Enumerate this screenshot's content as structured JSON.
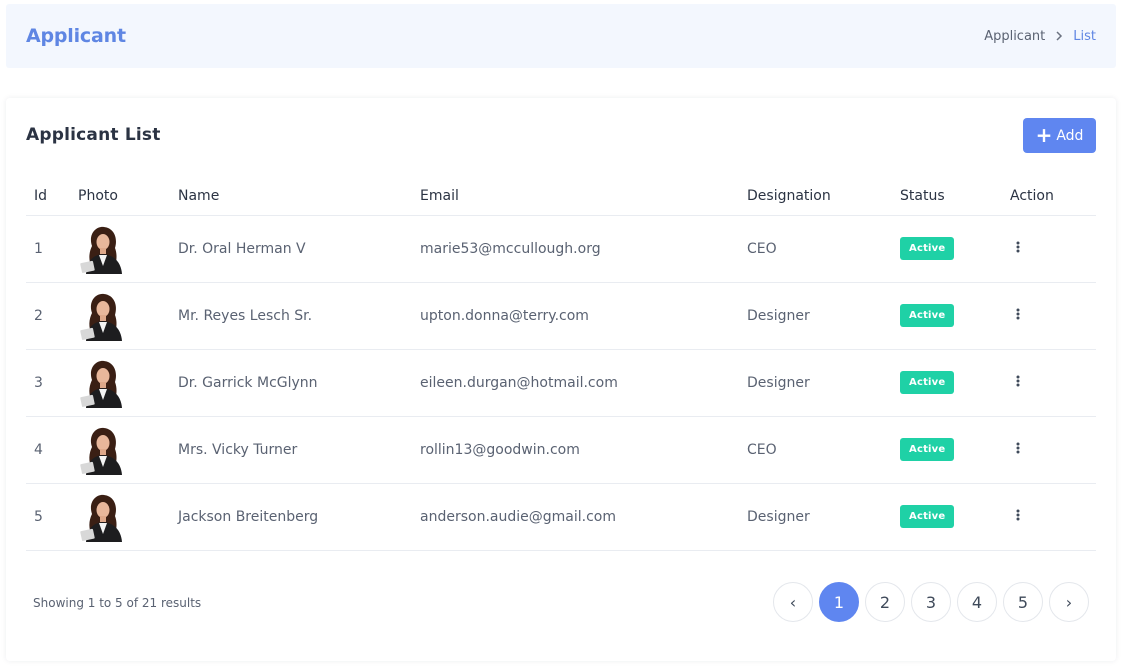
{
  "header": {
    "title": "Applicant",
    "breadcrumb": {
      "parent": "Applicant",
      "current": "List"
    }
  },
  "card": {
    "title": "Applicant List",
    "add_label": "Add"
  },
  "table": {
    "columns": [
      "Id",
      "Photo",
      "Name",
      "Email",
      "Designation",
      "Status",
      "Action"
    ],
    "rows": [
      {
        "id": "1",
        "name": "Dr. Oral Herman V",
        "email": "marie53@mccullough.org",
        "designation": "CEO",
        "status": "Active"
      },
      {
        "id": "2",
        "name": "Mr. Reyes Lesch Sr.",
        "email": "upton.donna@terry.com",
        "designation": "Designer",
        "status": "Active"
      },
      {
        "id": "3",
        "name": "Dr. Garrick McGlynn",
        "email": "eileen.durgan@hotmail.com",
        "designation": "Designer",
        "status": "Active"
      },
      {
        "id": "4",
        "name": "Mrs. Vicky Turner",
        "email": "rollin13@goodwin.com",
        "designation": "CEO",
        "status": "Active"
      },
      {
        "id": "5",
        "name": "Jackson Breitenberg",
        "email": "anderson.audie@gmail.com",
        "designation": "Designer",
        "status": "Active"
      }
    ]
  },
  "pagination": {
    "summary": "Showing 1 to 5 of 21 results",
    "prev": "‹",
    "next": "›",
    "pages": [
      "1",
      "2",
      "3",
      "4",
      "5"
    ],
    "current": "1"
  },
  "colors": {
    "accent": "#5f86f0",
    "title": "#5f86e3",
    "status_active": "#1fd1a6",
    "header_bg": "#f3f7fe"
  },
  "icons": {
    "breadcrumb_separator": "chevron-right-icon",
    "add": "plus-icon",
    "row_action": "more-vertical-icon",
    "photo": "avatar-photo"
  }
}
